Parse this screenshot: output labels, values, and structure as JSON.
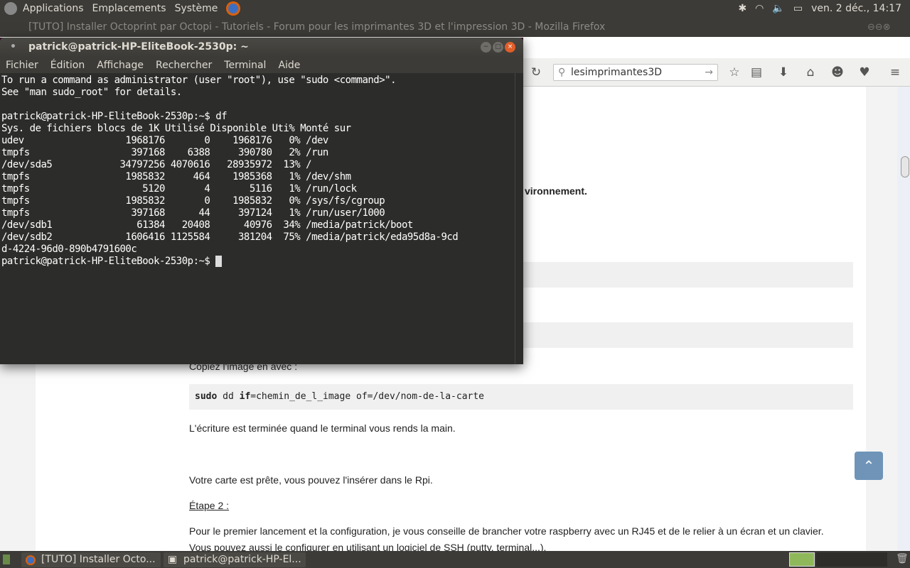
{
  "top_panel": {
    "menus": [
      "Applications",
      "Emplacements",
      "Système"
    ],
    "clock": "ven. 2 déc., 14:17"
  },
  "firefox": {
    "window_title": "[TUTO] Installer Octoprint par Octopi - Tutoriels - Forum pour les imprimantes 3D et l'impression 3D - Mozilla Firefox",
    "search_value": "lesimprimantes3D"
  },
  "page": {
    "bold_fragment": "vironnement.",
    "para1": "Copiez l'image en avec :",
    "code_cmd": "sudo",
    "code_mid": " dd ",
    "code_kw": "if",
    "code_rest": "=chemin_de_l_image of=/dev/nom-de-la-carte",
    "para2": "L'écriture est terminée quand le terminal vous rends la main.",
    "para3": "Votre carte est prête, vous pouvez l'insérer dans le Rpi.",
    "step": "Étape 2 :",
    "para4": "Pour le premier lancement et la configuration, je vous conseille de brancher votre raspberry avec un RJ45 et de le relier à un écran et un clavier.",
    "para5": "Vous pouvez aussi le configurer en utilisant un logiciel de SSH (putty, terminal...)."
  },
  "terminal": {
    "title": "patrick@patrick-HP-EliteBook-2530p: ~",
    "menus": [
      "Fichier",
      "Édition",
      "Affichage",
      "Rechercher",
      "Terminal",
      "Aide"
    ],
    "lines": [
      "To run a command as administrator (user \"root\"), use \"sudo <command>\".",
      "See \"man sudo_root\" for details.",
      "",
      "patrick@patrick-HP-EliteBook-2530p:~$ df",
      "Sys. de fichiers blocs de 1K Utilisé Disponible Uti% Monté sur",
      "udev                  1968176       0    1968176   0% /dev",
      "tmpfs                  397168    6388     390780   2% /run",
      "/dev/sda5            34797256 4070616   28935972  13% /",
      "tmpfs                 1985832     464    1985368   1% /dev/shm",
      "tmpfs                    5120       4       5116   1% /run/lock",
      "tmpfs                 1985832       0    1985832   0% /sys/fs/cgroup",
      "tmpfs                  397168      44     397124   1% /run/user/1000",
      "/dev/sdb1               61384   20408      40976  34% /media/patrick/boot",
      "/dev/sdb2             1606416 1125584     381204  75% /media/patrick/eda95d8a-9cd",
      "d-4224-96d0-890b4791600c",
      "patrick@patrick-HP-EliteBook-2530p:~$ "
    ]
  },
  "taskbar": {
    "tasks": [
      "[TUTO] Installer Octo...",
      "patrick@patrick-HP-El..."
    ]
  }
}
